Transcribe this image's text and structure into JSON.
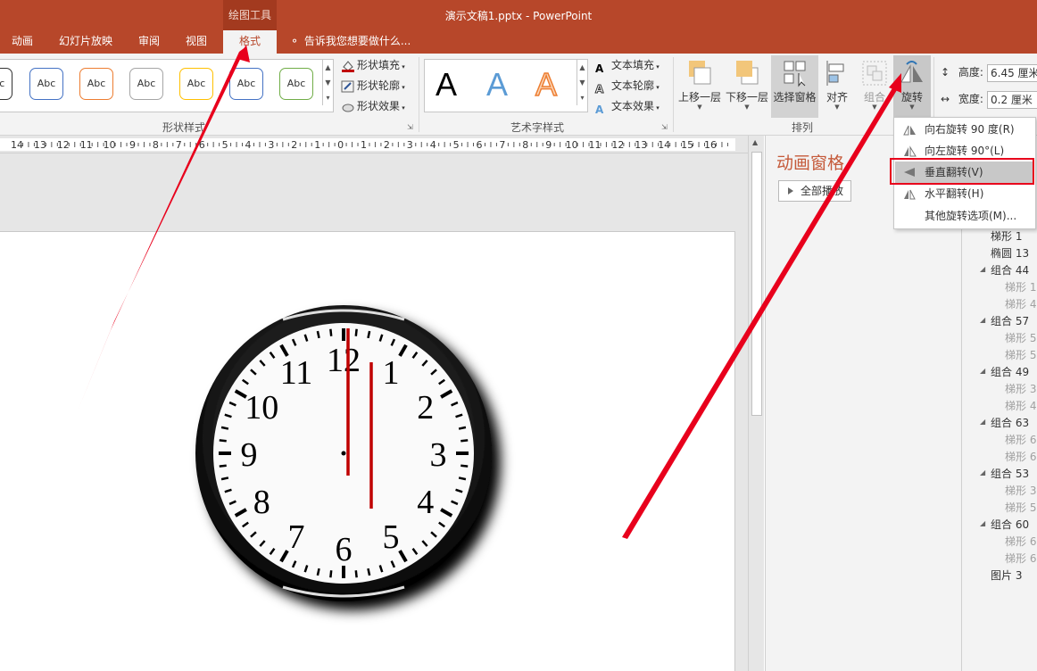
{
  "titlebar": {
    "context_tool": "绘图工具",
    "document_title": "演示文稿1.pptx - PowerPoint"
  },
  "tabs": [
    {
      "label": "动画"
    },
    {
      "label": "幻灯片放映"
    },
    {
      "label": "审阅"
    },
    {
      "label": "视图"
    },
    {
      "label": "格式",
      "active": true
    }
  ],
  "tellme": "告诉我您想要做什么...",
  "ribbon": {
    "shape_styles": {
      "label": "形状样式",
      "thumb_text": "Abc",
      "commands": {
        "fill": "形状填充",
        "outline": "形状轮廓",
        "effects": "形状效果"
      },
      "thumb_colors": [
        "#333333",
        "#4472c4",
        "#ed7d31",
        "#a5a5a5",
        "#ffc000",
        "#4472c4",
        "#70ad47"
      ]
    },
    "art_styles": {
      "label": "艺术字样式",
      "letter": "A",
      "commands": {
        "fill": "文本填充",
        "outline": "文本轮廓",
        "effects": "文本效果"
      }
    },
    "arrange": {
      "label": "排列",
      "bring_forward": "上移一层",
      "send_backward": "下移一层",
      "selection_pane": "选择窗格",
      "align": "对齐",
      "group": "组合",
      "rotate": "旋转"
    },
    "size": {
      "height_label": "高度:",
      "height_value": "6.45 厘米",
      "width_label": "宽度:",
      "width_value": "0.2 厘米"
    }
  },
  "ruler": {
    "labels": [
      "14",
      "13",
      "12",
      "11",
      "10",
      "9",
      "8",
      "7",
      "6",
      "5",
      "4",
      "3",
      "2",
      "1",
      "0",
      "1",
      "2",
      "3",
      "4",
      "5",
      "6",
      "7",
      "8",
      "9",
      "10",
      "11",
      "12",
      "13",
      "14",
      "15",
      "16"
    ]
  },
  "clock": {
    "numerals": [
      "12",
      "1",
      "2",
      "3",
      "4",
      "5",
      "6",
      "7",
      "8",
      "9",
      "10",
      "11"
    ]
  },
  "animation_pane": {
    "title": "动画窗格",
    "play_all": "全部播放"
  },
  "rotate_menu": {
    "items": [
      {
        "label": "向右旋转 90 度(R)"
      },
      {
        "label": "向左旋转 90°(L)"
      },
      {
        "label": "垂直翻转(V)",
        "highlighted": true
      },
      {
        "label": "水平翻转(H)"
      },
      {
        "label": "其他旋转选项(M)..."
      }
    ]
  },
  "selection_pane": {
    "items": [
      {
        "label": "梯形 1",
        "level": 0
      },
      {
        "label": "椭圆 13",
        "level": 0
      },
      {
        "label": "组合 44",
        "level": 0,
        "group": true
      },
      {
        "label": "梯形 1",
        "level": 1
      },
      {
        "label": "梯形 4",
        "level": 1
      },
      {
        "label": "组合 57",
        "level": 0,
        "group": true
      },
      {
        "label": "梯形 5",
        "level": 1
      },
      {
        "label": "梯形 5",
        "level": 1
      },
      {
        "label": "组合 49",
        "level": 0,
        "group": true
      },
      {
        "label": "梯形 3",
        "level": 1
      },
      {
        "label": "梯形 4",
        "level": 1
      },
      {
        "label": "组合 63",
        "level": 0,
        "group": true
      },
      {
        "label": "梯形 6",
        "level": 1
      },
      {
        "label": "梯形 6",
        "level": 1
      },
      {
        "label": "组合 53",
        "level": 0,
        "group": true
      },
      {
        "label": "梯形 3",
        "level": 1
      },
      {
        "label": "梯形 5",
        "level": 1
      },
      {
        "label": "组合 60",
        "level": 0,
        "group": true
      },
      {
        "label": "梯形 6",
        "level": 1
      },
      {
        "label": "梯形 6",
        "level": 1
      },
      {
        "label": "图片 3",
        "level": 0
      }
    ]
  },
  "colors": {
    "brand": "#b7472a",
    "highlight_box": "#e8001c",
    "hand": "#c00000"
  }
}
